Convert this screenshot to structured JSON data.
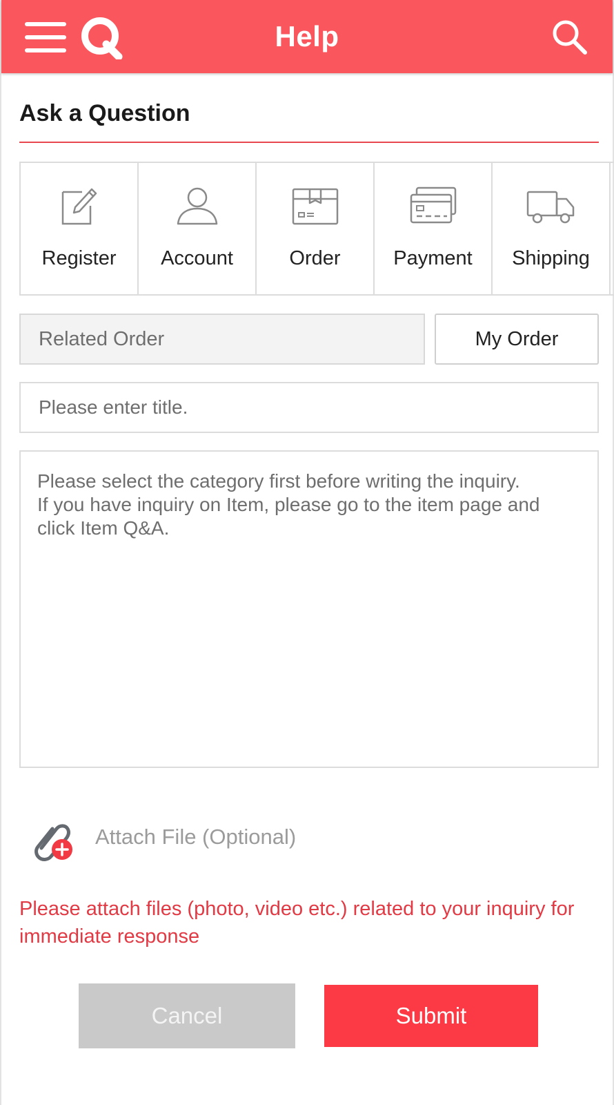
{
  "header": {
    "title": "Help",
    "menu_icon": "hamburger-menu-icon",
    "logo_icon": "q-logo-icon",
    "search_icon": "search-icon",
    "background_color": "#f9565e"
  },
  "section": {
    "title": "Ask a Question",
    "rule_color": "#e8474f"
  },
  "categories": [
    {
      "label": "Register",
      "icon": "pencil-edit-icon"
    },
    {
      "label": "Account",
      "icon": "user-icon"
    },
    {
      "label": "Order",
      "icon": "package-box-icon"
    },
    {
      "label": "Payment",
      "icon": "credit-card-icon"
    },
    {
      "label": "Shipping",
      "icon": "delivery-truck-icon"
    }
  ],
  "related_order": {
    "label": "Related Order",
    "button_label": "My Order"
  },
  "form": {
    "title_placeholder": "Please enter title.",
    "inquiry_placeholder": "Please select the category first before writing the inquiry.\nIf you have inquiry on Item, please go to the item page and click Item Q&A.",
    "attach_label": "Attach File (Optional)",
    "attach_icon": "paperclip-add-icon",
    "notice": "Please attach files (photo, video etc.) related to your inquiry for immediate response",
    "notice_color": "#e23a44"
  },
  "actions": {
    "cancel_label": "Cancel",
    "submit_label": "Submit",
    "submit_color": "#fb3a45",
    "cancel_color": "#c9c9c9"
  }
}
